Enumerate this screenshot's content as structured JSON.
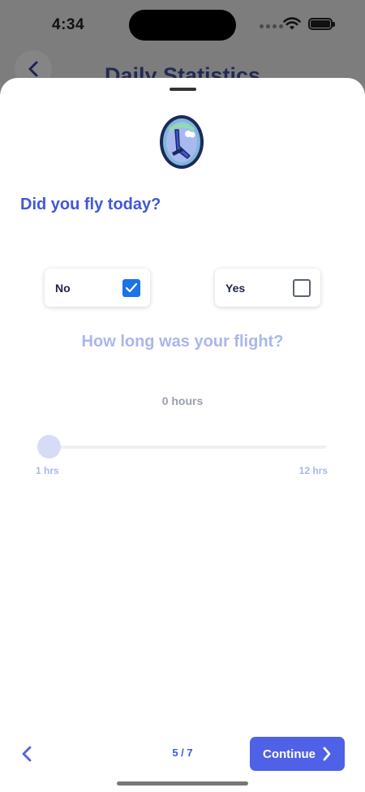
{
  "status_bar": {
    "time": "4:34"
  },
  "background_page": {
    "title": "Daily Statistics"
  },
  "question": {
    "text": "Did you fly today?"
  },
  "options": [
    {
      "label": "No",
      "checked": true
    },
    {
      "label": "Yes",
      "checked": false
    }
  ],
  "flight_duration": {
    "question": "How long was your flight?",
    "value_text": "0 hours",
    "slider_min_label": "1 hrs",
    "slider_max_label": "12 hrs",
    "slider_value": 0
  },
  "footer": {
    "page_indicator": "5 / 7",
    "continue_label": "Continue"
  },
  "colors": {
    "accent": "#3f58d8",
    "button": "#4f61e6",
    "muted_accent": "#a9b7ee",
    "checkbox_checked": "#1a73e8"
  },
  "icons": {
    "illustration": "airplane-window-icon",
    "back": "chevron-left-icon",
    "continue": "chevron-right-icon",
    "check": "checkmark-icon"
  }
}
